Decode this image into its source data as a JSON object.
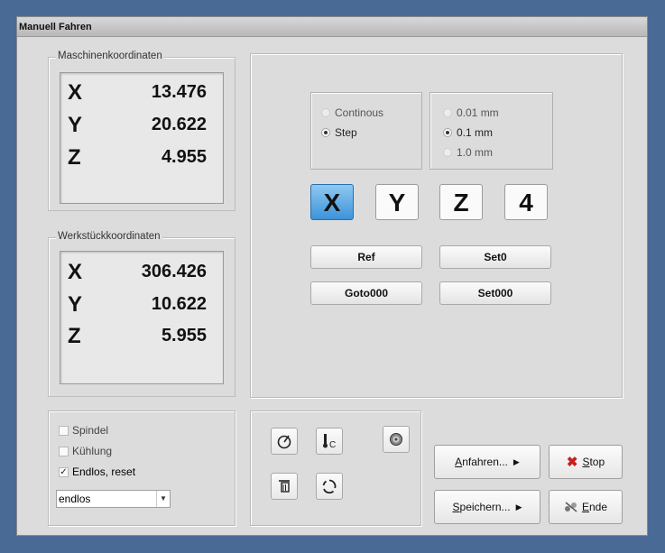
{
  "window": {
    "title": "Manuell Fahren"
  },
  "machine": {
    "legend": "Maschinenkoordinaten",
    "x_label": "X",
    "x_value": "13.476",
    "y_label": "Y",
    "y_value": "20.622",
    "z_label": "Z",
    "z_value": "4.955"
  },
  "work": {
    "legend": "Werkstückkoordinaten",
    "x_label": "X",
    "x_value": "306.426",
    "y_label": "Y",
    "y_value": "10.622",
    "z_label": "Z",
    "z_value": "5.955"
  },
  "mode": {
    "continous": "Continous",
    "step": "Step",
    "selected": "Step"
  },
  "stepsize": {
    "s1": "0.01 mm",
    "s2": "0.1 mm",
    "s3": "1.0 mm",
    "selected": "0.1 mm"
  },
  "axes": {
    "x": "X",
    "y": "Y",
    "z": "Z",
    "a4": "4",
    "selected": "X"
  },
  "buttons": {
    "ref": "Ref",
    "set0": "Set0",
    "goto000": "Goto000",
    "set000": "Set000"
  },
  "options": {
    "spindel": "Spindel",
    "kuehlung": "Kühlung",
    "endlos": "Endlos, reset",
    "mode_value": "endlos"
  },
  "actions": {
    "anfahren_a": "A",
    "anfahren_b": "nfahren...",
    "speichern_a": "S",
    "speichern_b": "peichern...",
    "stop_a": "S",
    "stop_b": "top",
    "ende_a": "E",
    "ende_b": "nde"
  },
  "colors": {
    "active_axis": "#3d93d9",
    "stop_x": "#c81e1e",
    "frame": "#4a6a96"
  }
}
